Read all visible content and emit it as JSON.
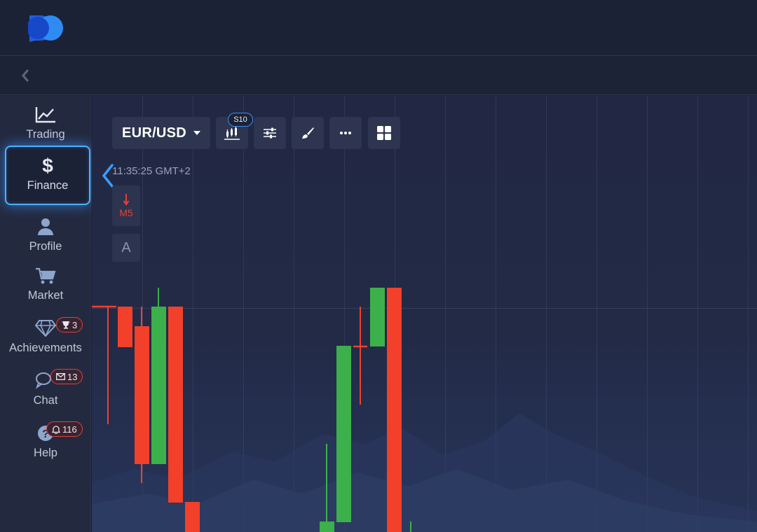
{
  "header": {
    "logo": "logo-icon"
  },
  "subbar": {
    "back_icon": "chevron-left-icon"
  },
  "sidebar": {
    "items": [
      {
        "label": "Trading",
        "icon": "chart-line-icon"
      },
      {
        "label": "Finance",
        "icon": "dollar-icon",
        "active": true
      },
      {
        "label": "Profile",
        "icon": "user-icon"
      },
      {
        "label": "Market",
        "icon": "cart-icon"
      },
      {
        "label": "Achievements",
        "icon": "diamond-icon",
        "badge": "3",
        "badge_icon": "trophy-icon"
      },
      {
        "label": "Chat",
        "icon": "chat-icon",
        "badge": "13",
        "badge_icon": "envelope-icon"
      },
      {
        "label": "Help",
        "icon": "help-icon",
        "badge": "116",
        "badge_icon": "bell-icon"
      }
    ]
  },
  "toolbar": {
    "pair": "EUR/USD",
    "timeframe_badge": "S10",
    "tools": [
      "candles-icon",
      "sliders-icon",
      "brush-icon",
      "more-icon",
      "grid-layout-icon"
    ]
  },
  "chart": {
    "time": "11:35:25 GMT+2",
    "period": "M5",
    "auto_label": "A",
    "colors": {
      "up": "#3cb04a",
      "down": "#f2402a"
    }
  }
}
